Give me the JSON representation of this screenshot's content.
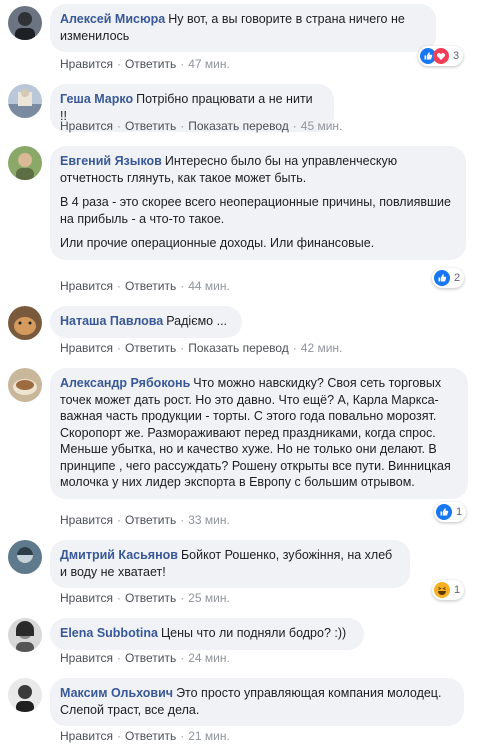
{
  "colors": {
    "author": "#385898",
    "bubble": "#f0f2f5",
    "like": "#1877f2",
    "heart": "#f33e58",
    "haha": "#f7b125"
  },
  "actions": {
    "like": "Нравится",
    "reply": "Ответить",
    "translate": "Показать перевод",
    "sep": "·"
  },
  "comments": [
    {
      "author": "Алексей Мисюра",
      "paragraphs": [
        "Ну вот, а вы говорите в страна ничего не изменилось"
      ],
      "time": "47 мин.",
      "reactions": [
        "like-icon",
        "love-icon"
      ],
      "reaction_count": "3",
      "show_translate": false
    },
    {
      "author": "Геша Марко",
      "paragraphs": [
        "Потрібно працювати а не нити !!"
      ],
      "time": "45 мин.",
      "show_translate": true
    },
    {
      "author": "Евгений Языков",
      "paragraphs": [
        "Интересно было бы на управленческую отчетность глянуть, как такое может быть.",
        "В 4 раза - это скорее всего неоперационные причины, повлиявшие на прибыль - а что-то такое.",
        "Или прочие операционные доходы. Или финансовые."
      ],
      "time": "44 мин.",
      "reactions": [
        "like-icon"
      ],
      "reaction_count": "2",
      "show_translate": false
    },
    {
      "author": "Наташа Павлова",
      "paragraphs": [
        "Радіємо ..."
      ],
      "time": "42 мин.",
      "show_translate": true
    },
    {
      "author": "Александр Рябоконь",
      "paragraphs": [
        "Что можно навскидку? Своя сеть торговых точек может дать рост. Но это давно. Что ещё? А, Карла Маркса- важная часть продукции - торты. С этого года повально морозят. Скоропорт же. Размораживают перед праздниками, когда спрос. Меньше убытка, но и качество хуже. Но не только они делают. В принципе , чего рассуждать? Рошену открыты все пути. Винницкая молочка у них лидер экспорта в Европу с большим отрывом."
      ],
      "time": "33 мин.",
      "reactions": [
        "like-icon"
      ],
      "reaction_count": "1",
      "show_translate": false
    },
    {
      "author": "Дмитрий Касьянов",
      "paragraphs": [
        "Бойкот Рошенко, зубожіння, на хлеб и воду не хватает!"
      ],
      "time": "25 мин.",
      "reactions": [
        "haha-icon"
      ],
      "reaction_count": "1",
      "show_translate": false
    },
    {
      "author": "Elena Subbotina",
      "paragraphs": [
        "Цены что ли подняли бодро? :))"
      ],
      "time": "24 мин.",
      "show_translate": false
    },
    {
      "author": "Максим Ольхович",
      "paragraphs": [
        "Это просто управляющая компания молодец. Слепой траст, все дела."
      ],
      "time": "21 мин.",
      "show_translate": false
    }
  ]
}
